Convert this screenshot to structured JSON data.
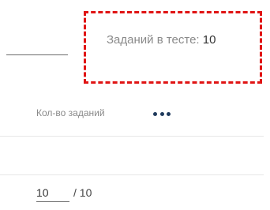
{
  "summary": {
    "label": "Заданий в тесте:",
    "value": "10"
  },
  "table": {
    "column_header": "Кол-во заданий",
    "more_icon": "more-horizontal-icon",
    "row": {
      "count_value": "10",
      "total_text": "/ 10"
    }
  },
  "colors": {
    "callout_border": "#e01414",
    "more_dots": "#1f3a5c"
  }
}
